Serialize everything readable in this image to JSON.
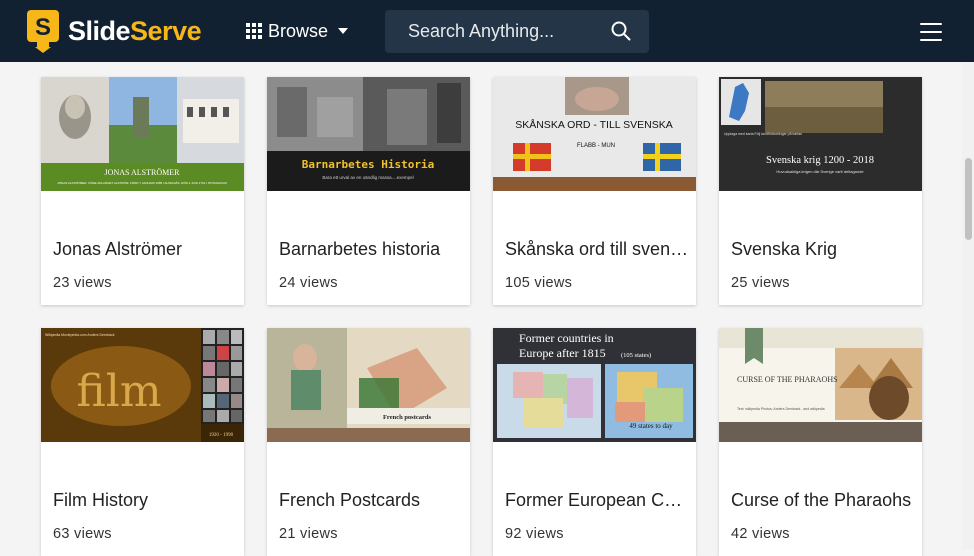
{
  "header": {
    "logo": {
      "part1": "Slide",
      "part2": "Serve",
      "badge_letter": "S"
    },
    "browse_label": "Browse",
    "search_placeholder": "Search Anything...",
    "colors": {
      "bar": "#122131",
      "accent": "#f7b718",
      "search_bg": "#243547"
    }
  },
  "cards": [
    {
      "title": "Jonas Alströmer",
      "views": "23 views",
      "thumb_text": [
        "JONAS ALSTRÖMER",
        "JONAS ALSTRÖMER, FÖRE ADLANDET ALSTRÖM, FÖDD 7 JANUARI 1685 I ALINGSÅS, DÖD 2 JUNI 1761 I STOCKHOLM"
      ]
    },
    {
      "title": "Barnarbetes historia",
      "views": "24 views",
      "thumb_text": [
        "Barnarbetes Historia",
        "Bara ett urval av en oändlig massa....exempel"
      ]
    },
    {
      "title": "Skånska ord till svenska",
      "views": "105 views",
      "thumb_text": [
        "SKÅNSKA ORD - TILL SVENSKA",
        "FLABB - MUN"
      ]
    },
    {
      "title": "Svenska Krig",
      "views": "25 views",
      "thumb_text": [
        "Svenska krig 1200 - 2018",
        "Huvudsakliga krigen där Sverige varit deltagande",
        "Upplaga med karta Följ landförändringar på kartan"
      ]
    },
    {
      "title": "Film History",
      "views": "63 views",
      "thumb_text": [
        "film",
        "Wikipedia Moviepedia.com Anders Dernback",
        "1920 - 1990"
      ]
    },
    {
      "title": "French Postcards",
      "views": "21 views",
      "thumb_text": [
        "French postcards"
      ]
    },
    {
      "title": "Former European Countries",
      "views": "92 views",
      "thumb_text": [
        "Former countries in",
        "Europe after 1815",
        "(105 states)",
        "49 states to day"
      ]
    },
    {
      "title": "Curse of the Pharaohs",
      "views": "42 views",
      "thumb_text": [
        "CURSE OF THE PHARAOHS",
        "Text: wikipedia Photos: Anders Dernback , and wikipedia"
      ]
    }
  ]
}
